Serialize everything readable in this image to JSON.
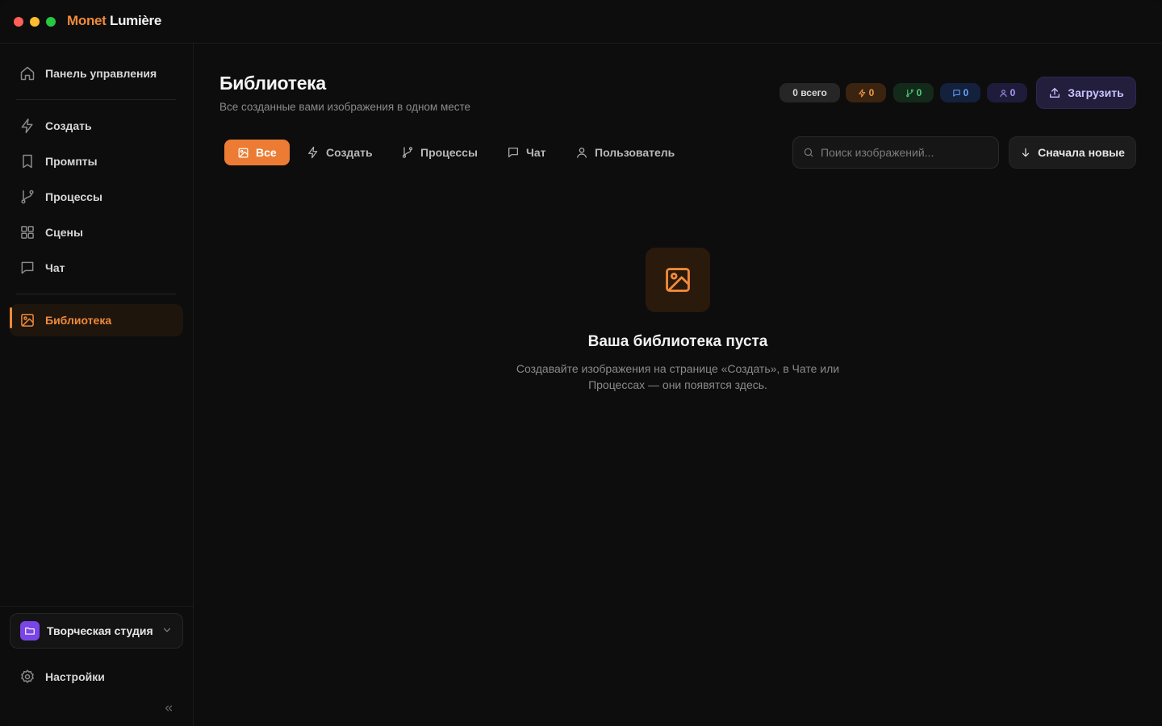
{
  "app": {
    "brand_part1": "Monet",
    "brand_part2": "Lumière",
    "accent_color": "#f08a3a"
  },
  "sidebar": {
    "items": [
      {
        "label": "Панель управления",
        "icon": "home-icon"
      },
      {
        "label": "Создать",
        "icon": "bolt-icon"
      },
      {
        "label": "Промпты",
        "icon": "bookmark-icon"
      },
      {
        "label": "Процессы",
        "icon": "git-branch-icon"
      },
      {
        "label": "Сцены",
        "icon": "grid-icon"
      },
      {
        "label": "Чат",
        "icon": "chat-icon"
      },
      {
        "label": "Библиотека",
        "icon": "image-icon",
        "active": true
      }
    ],
    "workspace": {
      "label": "Творческая студия",
      "icon": "folder-icon",
      "color": "#7a45e6"
    },
    "settings_label": "Настройки"
  },
  "header": {
    "title": "Библиотека",
    "subtitle": "Все созданные вами изображения в одном месте",
    "badges": {
      "all": "0 всего",
      "create": "0",
      "flows": "0",
      "chat": "0",
      "user": "0"
    },
    "upload_label": "Загрузить"
  },
  "filters": {
    "tabs": [
      {
        "label": "Все",
        "active": true
      },
      {
        "label": "Создать"
      },
      {
        "label": "Процессы"
      },
      {
        "label": "Чат"
      },
      {
        "label": "Пользователь"
      }
    ],
    "search_placeholder": "Поиск изображений...",
    "sort_label": "Сначала новые"
  },
  "empty_state": {
    "title": "Ваша библиотека пуста",
    "description": "Создавайте изображения на странице «Создать», в Чате или Процессах — они появятся здесь."
  }
}
